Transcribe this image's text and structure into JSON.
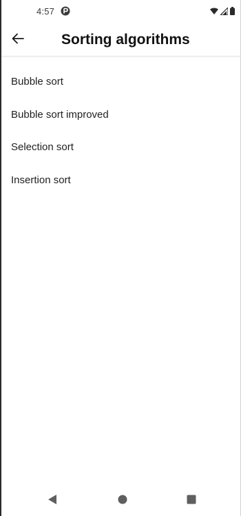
{
  "status_bar": {
    "time": "4:57",
    "app_icon": "debug-app-icon",
    "wifi_icon": "wifi-icon",
    "signal_icon": "cell-signal-icon",
    "battery_icon": "battery-icon"
  },
  "app_bar": {
    "back_icon": "arrow-back-icon",
    "title": "Sorting algorithms"
  },
  "algorithms": [
    {
      "label": "Bubble sort"
    },
    {
      "label": "Bubble sort improved"
    },
    {
      "label": "Selection sort"
    },
    {
      "label": "Insertion sort"
    }
  ],
  "nav_bar": {
    "back_icon": "nav-back-triangle-icon",
    "home_icon": "nav-home-circle-icon",
    "recents_icon": "nav-recents-square-icon"
  },
  "colors": {
    "background": "#ffffff",
    "text": "#1f1f1f",
    "icon": "#5f5f5f"
  }
}
